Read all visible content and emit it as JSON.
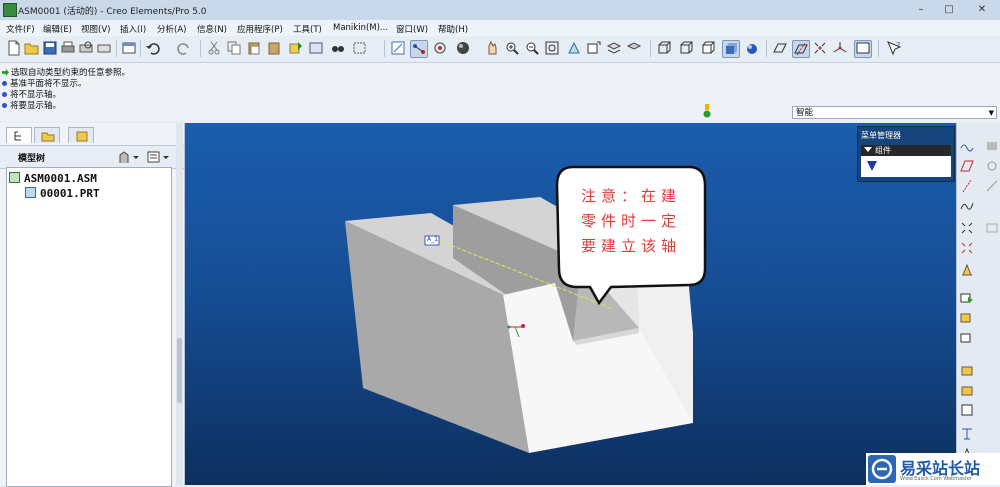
{
  "window": {
    "title": "ASM0001 (活动的) - Creo Elements/Pro 5.0",
    "controls": {
      "minimize": "–",
      "maximize": "□",
      "close": "✕"
    }
  },
  "menubar": {
    "items": [
      "文件(F)",
      "编辑(E)",
      "视图(V)",
      "插入(I)",
      "分析(A)",
      "信息(N)",
      "应用程序(P)",
      "工具(T)",
      "Manikin(M)...",
      "窗口(W)",
      "帮助(H)"
    ]
  },
  "messages": [
    "选取自动类型约束的任意参照。",
    "基准平面将不显示。",
    "将不显示轴。",
    "将要显示轴。"
  ],
  "filter": {
    "value": "智能"
  },
  "model_tree": {
    "header": "模型树",
    "items": [
      "ASM0001.ASM",
      "00001.PRT"
    ]
  },
  "menu_manager": {
    "title": "菜单管理器",
    "group_label": "组件"
  },
  "annotation": {
    "lines": [
      "注意：在建",
      "零件时一定",
      "要建立该轴"
    ],
    "color": "#e33a3a"
  },
  "axis_label": "A_1",
  "watermark": {
    "text": "易采站长站",
    "subtext": "Www.Easck.Com Webmaster"
  },
  "colors": {
    "viewport_top": "#1b5dae",
    "viewport_bottom": "#0d2f5f",
    "axis": "#e8e84a"
  },
  "icons": {
    "toolbar": [
      "new-icon",
      "open-icon",
      "save-icon",
      "print-icon",
      "undo-icon",
      "redo-icon",
      "cut-icon",
      "copy-icon",
      "paste-icon",
      "regenerate-icon",
      "find-icon",
      "select-box-icon",
      "repaint-icon",
      "spin-center-icon",
      "orient-icon",
      "appearance-icon",
      "pan-icon",
      "zoom-in-icon",
      "zoom-out-icon",
      "refit-icon",
      "view-manager-icon",
      "layers-icon",
      "wireframe-icon",
      "hidden-line-icon",
      "no-hidden-icon",
      "shading-icon",
      "plane-display-icon",
      "axis-display-icon",
      "point-display-icon",
      "csys-display-icon",
      "whats-this-icon"
    ],
    "right": [
      "sketch-icon",
      "datum-plane-icon",
      "datum-axis-icon",
      "datum-curve-icon",
      "datum-point-icon",
      "csys-icon",
      "analysis-icon",
      "assemble-icon",
      "create-component-icon",
      "pattern-icon"
    ]
  }
}
